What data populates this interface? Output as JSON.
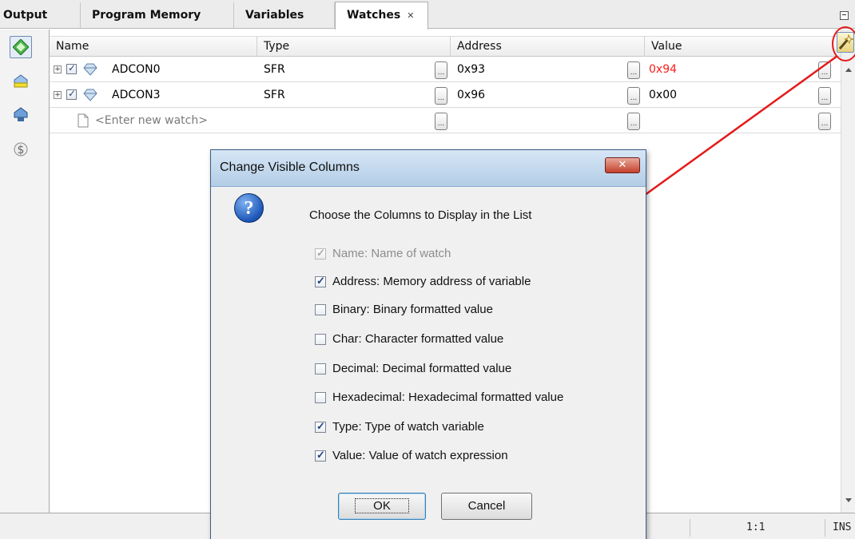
{
  "tabs": [
    {
      "label": "Output",
      "active": false
    },
    {
      "label": "Program Memory",
      "active": false
    },
    {
      "label": "Variables",
      "active": false
    },
    {
      "label": "Watches",
      "active": true,
      "close_glyph": "✕"
    }
  ],
  "columns": {
    "name": "Name",
    "type": "Type",
    "address": "Address",
    "value": "Value"
  },
  "rows": [
    {
      "name": "ADCON0",
      "type": "SFR",
      "address": "0x93",
      "value": "0x94",
      "value_color": "#ff1a1a",
      "checked": true
    },
    {
      "name": "ADCON3",
      "type": "SFR",
      "address": "0x96",
      "value": "0x00",
      "value_color": "#000000",
      "checked": true
    }
  ],
  "new_watch_placeholder": "<Enter new watch>",
  "ellipsis": "...",
  "left_tools": [
    "add-watch-icon",
    "watch-yellow-icon",
    "watch-blue-icon",
    "dollar-icon"
  ],
  "status": {
    "position": "1:1",
    "mode": "INS"
  },
  "dialog": {
    "title": "Change Visible Columns",
    "close_label": "✕",
    "prompt": "Choose the Columns to Display in the List",
    "options": [
      {
        "label": "Name: Name of watch",
        "checked": true,
        "disabled": true
      },
      {
        "label": "Address: Memory address of variable",
        "checked": true,
        "disabled": false
      },
      {
        "label": "Binary: Binary formatted value",
        "checked": false,
        "disabled": false
      },
      {
        "label": "Char: Character formatted value",
        "checked": false,
        "disabled": false
      },
      {
        "label": "Decimal: Decimal formatted value",
        "checked": false,
        "disabled": false
      },
      {
        "label": "Hexadecimal: Hexadecimal formatted value",
        "checked": false,
        "disabled": false
      },
      {
        "label": "Type: Type of watch variable",
        "checked": true,
        "disabled": false
      },
      {
        "label": "Value: Value of watch expression",
        "checked": true,
        "disabled": false
      }
    ],
    "ok_label": "OK",
    "cancel_label": "Cancel"
  },
  "colors": {
    "annotation": "#e31b1b",
    "changed_value": "#ff1a1a"
  }
}
